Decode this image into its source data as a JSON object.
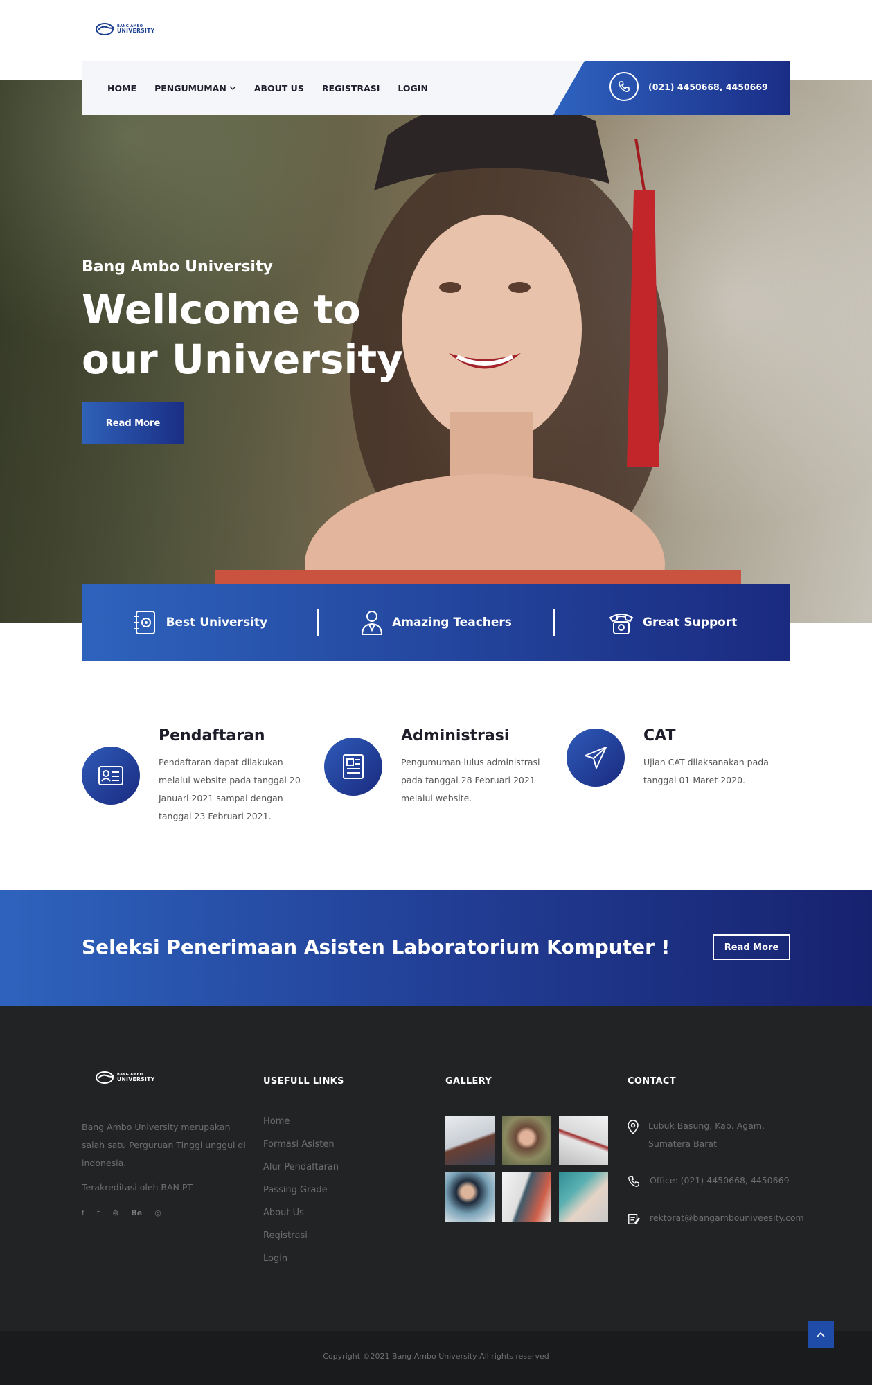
{
  "brand": {
    "line1": "BANG AMBO",
    "line2": "UNIVERSITY",
    "accent": "#1f4ca8",
    "dark": "#222325"
  },
  "nav": {
    "items": [
      "HOME",
      "PENGUMUMAN",
      "ABOUT US",
      "REGISTRASI",
      "LOGIN"
    ],
    "phone": "(021) 4450668, 4450669"
  },
  "hero": {
    "subtitle": "Bang Ambo University",
    "title": "Wellcome to our University",
    "button": "Read More"
  },
  "features": [
    {
      "label": "Best University",
      "icon": "notebook-icon"
    },
    {
      "label": "Amazing Teachers",
      "icon": "teacher-icon"
    },
    {
      "label": "Great Support",
      "icon": "telephone-icon"
    }
  ],
  "info": [
    {
      "title": "Pendaftaran",
      "text": "Pendaftaran dapat dilakukan melalui website pada tanggal 20 Januari 2021 sampai dengan tanggal 23 Februari 2021.",
      "icon": "id-card-icon"
    },
    {
      "title": "Administrasi",
      "text": "Pengumuman lulus administrasi pada tanggal 28 Februari 2021 melalui website.",
      "icon": "document-icon"
    },
    {
      "title": "CAT",
      "text": "Ujian CAT dilaksanakan pada tanggal 01 Maret 2020.",
      "icon": "paper-plane-icon"
    }
  ],
  "cta": {
    "text": "Seleksi Penerimaan Asisten Laboratorium Komputer !",
    "button": "Read More"
  },
  "footer": {
    "about": "Bang Ambo University merupakan salah satu Perguruan Tinggi unggul di indonesia.",
    "accreditation": "Terakreditasi oleh BAN PT",
    "social": [
      "f",
      "t",
      "d",
      "Bē",
      "ig"
    ],
    "links_title": "USEFULL LINKS",
    "links": [
      "Home",
      "Formasi Asisten",
      "Alur Pendaftaran",
      "Passing Grade",
      "About Us",
      "Registrasi",
      "Login"
    ],
    "gallery_title": "GALLERY",
    "contact_title": "CONTACT",
    "address": "Lubuk Basung, Kab. Agam, Sumatera Barat",
    "office": "Office: (021) 4450668, 4450669",
    "email": "rektorat@bangambouniveesity.com",
    "copyright": "Copyright ©2021 Bang Ambo University All rights reserved"
  }
}
